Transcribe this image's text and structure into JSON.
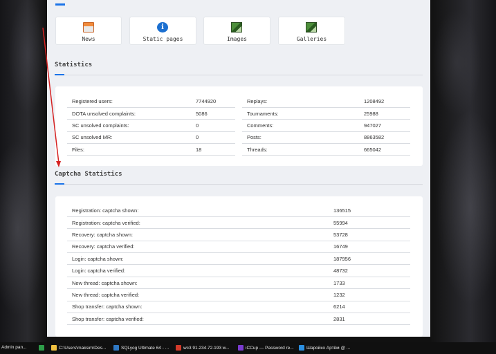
{
  "nav_tiles": [
    {
      "label": "News",
      "icon": "newspaper-icon"
    },
    {
      "label": "Static pages",
      "icon": "info-icon"
    },
    {
      "label": "Images",
      "icon": "image-icon"
    },
    {
      "label": "Galleries",
      "icon": "gallery-icon"
    }
  ],
  "statistics": {
    "title": "Statistics",
    "left": [
      {
        "label": "Registered users:",
        "value": "7744920"
      },
      {
        "label": "DOTA unsolved complaints:",
        "value": "5086"
      },
      {
        "label": "SC unsolved complaints:",
        "value": "0"
      },
      {
        "label": "SC unsolved MR:",
        "value": "0"
      },
      {
        "label": "Files:",
        "value": "18"
      }
    ],
    "right": [
      {
        "label": "Replays:",
        "value": "1208492"
      },
      {
        "label": "Tournaments:",
        "value": "25988"
      },
      {
        "label": "Comments:",
        "value": "947027"
      },
      {
        "label": "Posts:",
        "value": "8863582"
      },
      {
        "label": "Threads:",
        "value": "665042"
      }
    ]
  },
  "captcha": {
    "title": "Captcha Statistics",
    "rows": [
      {
        "label": "Registration: captcha shown:",
        "value": "136515"
      },
      {
        "label": "Registration: captcha verified:",
        "value": "55994"
      },
      {
        "label": "Recovery: captcha shown:",
        "value": "53728"
      },
      {
        "label": "Recovery: captcha verified:",
        "value": "16749"
      },
      {
        "label": "Login: captcha shown:",
        "value": "187956"
      },
      {
        "label": "Login: captcha verified:",
        "value": "48732"
      },
      {
        "label": "New thread: captcha shown:",
        "value": "1733"
      },
      {
        "label": "New thread: captcha verified:",
        "value": "1232"
      },
      {
        "label": "Shop transfer: captcha shown:",
        "value": "6214"
      },
      {
        "label": "Shop transfer: captcha verified:",
        "value": "2831"
      }
    ]
  },
  "taskbar": [
    {
      "label": "Admin pan...",
      "color": "#3a7bd5"
    },
    {
      "label": "",
      "color": "#2e9d49"
    },
    {
      "label": "C:\\Users\\maksim\\Des...",
      "color": "#f0c040"
    },
    {
      "label": "SQLyog Ultimate 64 - ...",
      "color": "#2f78c4"
    },
    {
      "label": "wc3  91.234.72.193 w...",
      "color": "#d23a2a"
    },
    {
      "label": "iCCup — Password re...",
      "color": "#7a3bd0"
    },
    {
      "label": "Шаройко Артём @ ...",
      "color": "#2b8fe0"
    }
  ]
}
